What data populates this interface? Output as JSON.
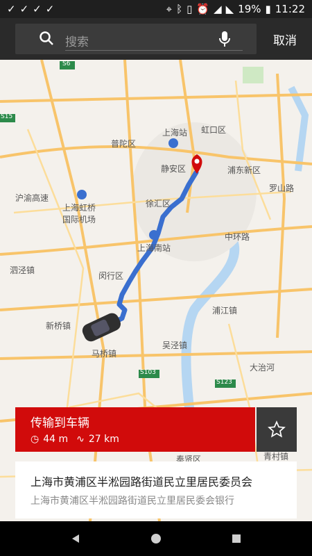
{
  "status_bar": {
    "battery": "19%",
    "time": "11:22"
  },
  "search": {
    "placeholder": "搜索",
    "cancel_label": "取消"
  },
  "map": {
    "labels": {
      "shanghai_station": "上海站",
      "hongkou": "虹口区",
      "putuo": "普陀区",
      "jingan": "静安区",
      "pudong": "浦东新区",
      "luoshan_road": "罗山路",
      "xuhui": "徐汇区",
      "hongqiao": "上海虹桥\n国际机场",
      "hu_yu_highway": "沪渝高速",
      "shanghai_south": "上海南站",
      "middle_ring": "中环路",
      "sijing": "泗泾镇",
      "minhang": "闵行区",
      "pujiang": "浦江镇",
      "xinqiao": "新桥镇",
      "majiang": "马桥镇",
      "wujing": "吴泾镇",
      "datuan": "大治河",
      "s6": "S6",
      "s15": "S15",
      "s103": "S103",
      "s123": "S123",
      "fengxian": "奉贤区",
      "qingcun": "青村镇"
    }
  },
  "card": {
    "title": "传输到车辆",
    "time": "44 m",
    "distance": "27 km"
  },
  "address": {
    "main": "上海市黄浦区半淞园路街道民立里居民委员会",
    "sub": "上海市黄浦区半淞园路街道民立里居民委会银行"
  },
  "colors": {
    "accent_red": "#d10b0b",
    "route_blue": "#3a6fcf"
  }
}
